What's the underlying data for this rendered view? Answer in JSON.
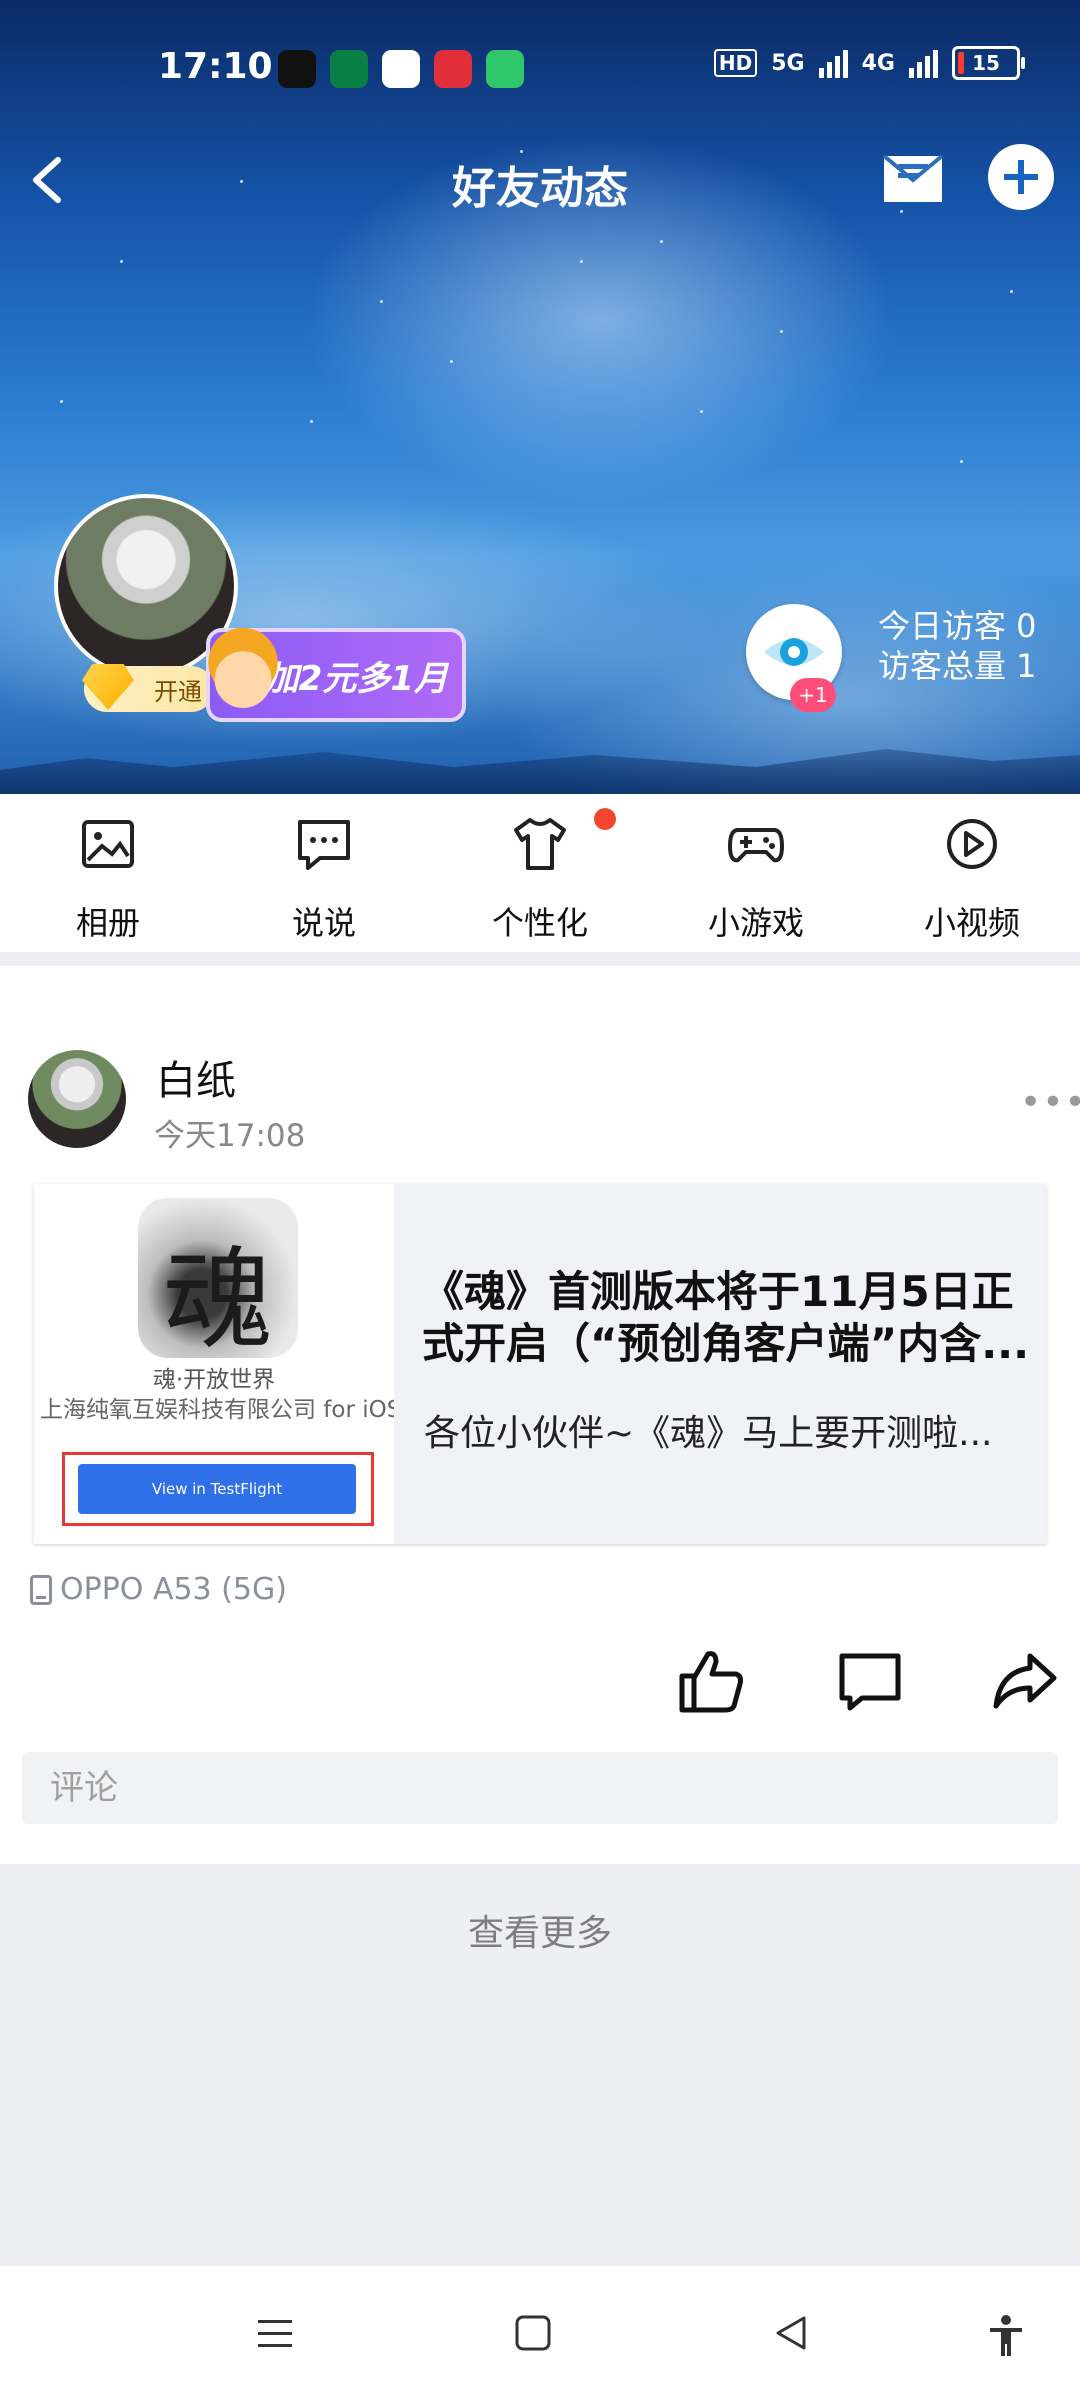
{
  "status": {
    "time": "17:10",
    "network": "5G",
    "network2": "4G",
    "battery": "15",
    "hd": "HD"
  },
  "header": {
    "title": "好友动态"
  },
  "profile": {
    "vip_label": "开通",
    "promo_text": "加2元多1月",
    "visitor_badge": "+1",
    "visitors_today": "今日访客 0",
    "visitors_total": "访客总量 1"
  },
  "shortcuts": [
    {
      "label": "相册",
      "icon": "photo-album-icon"
    },
    {
      "label": "说说",
      "icon": "chat-bubble-icon"
    },
    {
      "label": "个性化",
      "icon": "tshirt-icon"
    },
    {
      "label": "小游戏",
      "icon": "gamepad-icon"
    },
    {
      "label": "小视频",
      "icon": "play-circle-icon"
    }
  ],
  "post": {
    "author": "白纸",
    "time": "今天17:08",
    "more": "•••",
    "share": {
      "icon_glyph": "魂",
      "game_name": "魂·开放世界",
      "developer": "上海纯氧互娱科技有限公司 for iOS",
      "testflight_button": "View in TestFlight",
      "title": "《魂》首测版本将于11月5日正式开启（“预创角客户端”内含...",
      "desc": "各位小伙伴~《魂》马上要开测啦..."
    },
    "device": "OPPO A53 (5G)",
    "comment_placeholder": "评论"
  },
  "see_more": "查看更多",
  "colors": {
    "accent": "#1565c0",
    "badge": "#f5452f",
    "promo": "#8a5cf6"
  }
}
